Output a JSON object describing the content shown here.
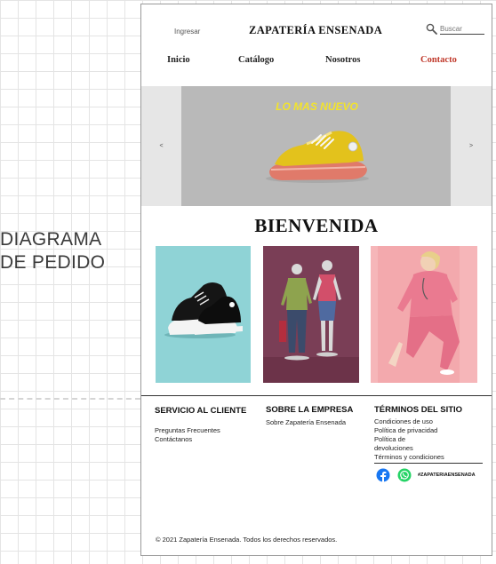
{
  "canvas_label": [
    "DIAGRAMA",
    "DE PEDIDO"
  ],
  "header": {
    "login_label": "Ingresar",
    "brand": "ZAPATERÍA ENSENADA",
    "search_placeholder": "Buscar"
  },
  "nav": {
    "items": [
      {
        "label": "Inicio"
      },
      {
        "label": "Catálogo"
      },
      {
        "label": "Nosotros"
      },
      {
        "label": "Contacto",
        "active": true
      }
    ]
  },
  "carousel": {
    "title": "LO MAS NUEVO",
    "prev_label": "<",
    "next_label": ">"
  },
  "welcome": "BIENVENIDA",
  "products": [
    "black-sneaker-image",
    "mannequins-image",
    "pink-scrubs-image"
  ],
  "footer": {
    "service": {
      "title": "SERVICIO AL CLIENTE",
      "links": [
        "Preguntas Frecuentes",
        "Contáctanos"
      ]
    },
    "company": {
      "title": "SOBRE LA EMPRESA",
      "links": [
        "Sobre Zapatería Ensenada"
      ]
    },
    "terms": {
      "title": "TÉRMINOS DEL SITIO",
      "links": [
        "Condiciones de uso",
        "Política de privacidad",
        "Política de devoluciones",
        "Términos y condiciones"
      ]
    },
    "hashtag": "#ZAPATERIAENSENADA",
    "copyright": "© 2021 Zapatería Ensenada. Todos los derechos reservados."
  },
  "colors": {
    "accent": "#c0392b",
    "slide_title": "#f2e32c",
    "facebook": "#1877f2",
    "whatsapp": "#25d366"
  }
}
